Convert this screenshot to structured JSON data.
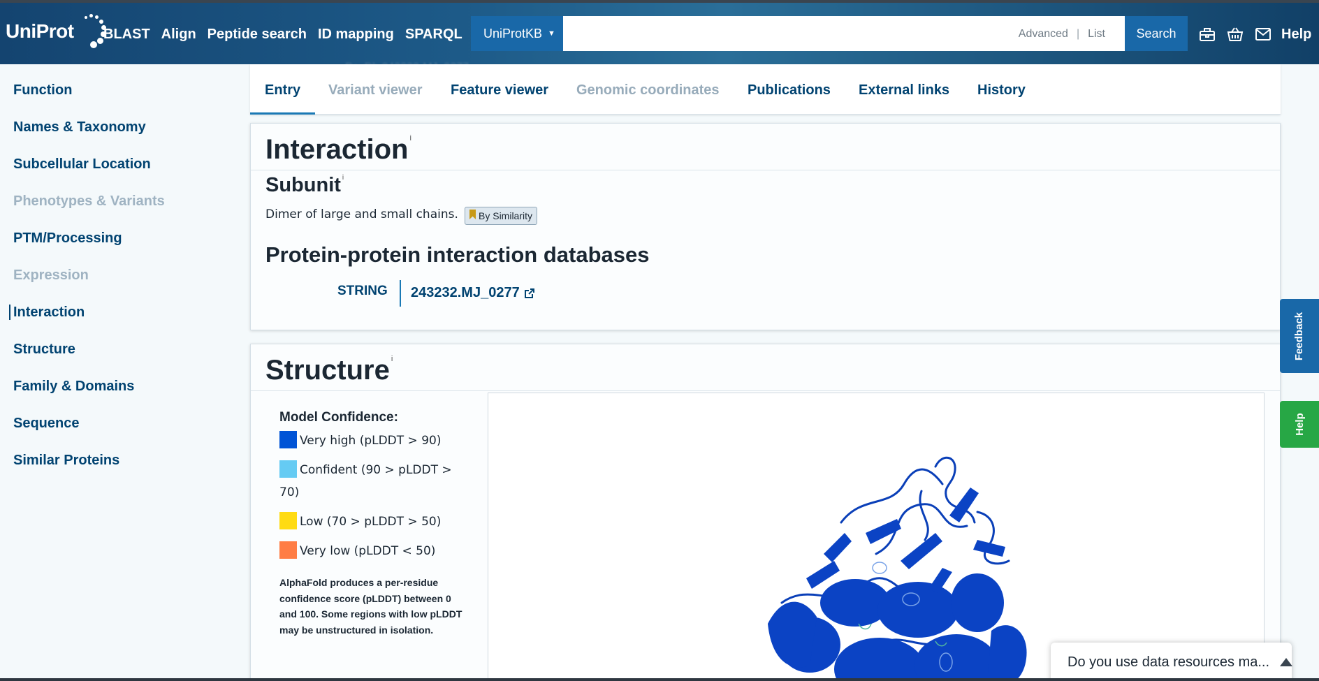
{
  "header": {
    "logo": "UniProt",
    "nav": [
      "BLAST",
      "Align",
      "Peptide search",
      "ID mapping",
      "SPARQL"
    ],
    "search": {
      "database": "UniProtKB",
      "placeholder": "",
      "advanced_label": "Advanced",
      "list_label": "List",
      "button_label": "Search"
    },
    "icons": [
      "toolbox-icon",
      "basket-icon",
      "mail-icon"
    ],
    "help_label": "Help"
  },
  "sidebar": {
    "items": [
      {
        "label": "Function",
        "muted": false
      },
      {
        "label": "Names & Taxonomy",
        "muted": false
      },
      {
        "label": "Subcellular Location",
        "muted": false
      },
      {
        "label": "Phenotypes & Variants",
        "muted": true
      },
      {
        "label": "PTM/Processing",
        "muted": false
      },
      {
        "label": "Expression",
        "muted": true
      },
      {
        "label": "Interaction",
        "muted": false,
        "active": true
      },
      {
        "label": "Structure",
        "muted": false
      },
      {
        "label": "Family & Domains",
        "muted": false
      },
      {
        "label": "Sequence",
        "muted": false
      },
      {
        "label": "Similar Proteins",
        "muted": false
      }
    ]
  },
  "tabs": [
    {
      "label": "Entry",
      "active": true,
      "muted": false
    },
    {
      "label": "Variant viewer",
      "muted": true
    },
    {
      "label": "Feature viewer",
      "muted": false
    },
    {
      "label": "Genomic coordinates",
      "muted": true
    },
    {
      "label": "Publications",
      "muted": false
    },
    {
      "label": "External links",
      "muted": false
    },
    {
      "label": "History",
      "muted": false
    }
  ],
  "ghost_text": "PaxDb    243232-MJ_0277",
  "interaction": {
    "title": "Interaction",
    "info_mark": "i",
    "subunit": {
      "heading": "Subunit",
      "text": "Dimer of large and small chains.",
      "evidence": "By Similarity"
    },
    "ppi": {
      "heading": "Protein-protein interaction databases",
      "db_name": "STRING",
      "db_link": "243232.MJ_0277"
    }
  },
  "structure": {
    "title": "Structure",
    "info_mark": "i",
    "legend_title": "Model Confidence:",
    "legend": [
      {
        "label": "Very high (pLDDT > 90)",
        "color": "#0053d6"
      },
      {
        "label": "Confident (90 > pLDDT > 70)",
        "color": "#65cbf3"
      },
      {
        "label": "Low (70 > pLDDT > 50)",
        "color": "#ffdb13"
      },
      {
        "label": "Very low (pLDDT < 50)",
        "color": "#ff7d45"
      }
    ],
    "note": "AlphaFold produces a per-residue confidence score (pLDDT) between 0 and 100. Some regions with low pLDDT may be unstructured in isolation."
  },
  "side_tabs": {
    "feedback": "Feedback",
    "help": "Help",
    "feedback_color": "#1968a8",
    "help_color": "#27a745"
  },
  "survey": {
    "text": "Do you use data resources ma..."
  }
}
